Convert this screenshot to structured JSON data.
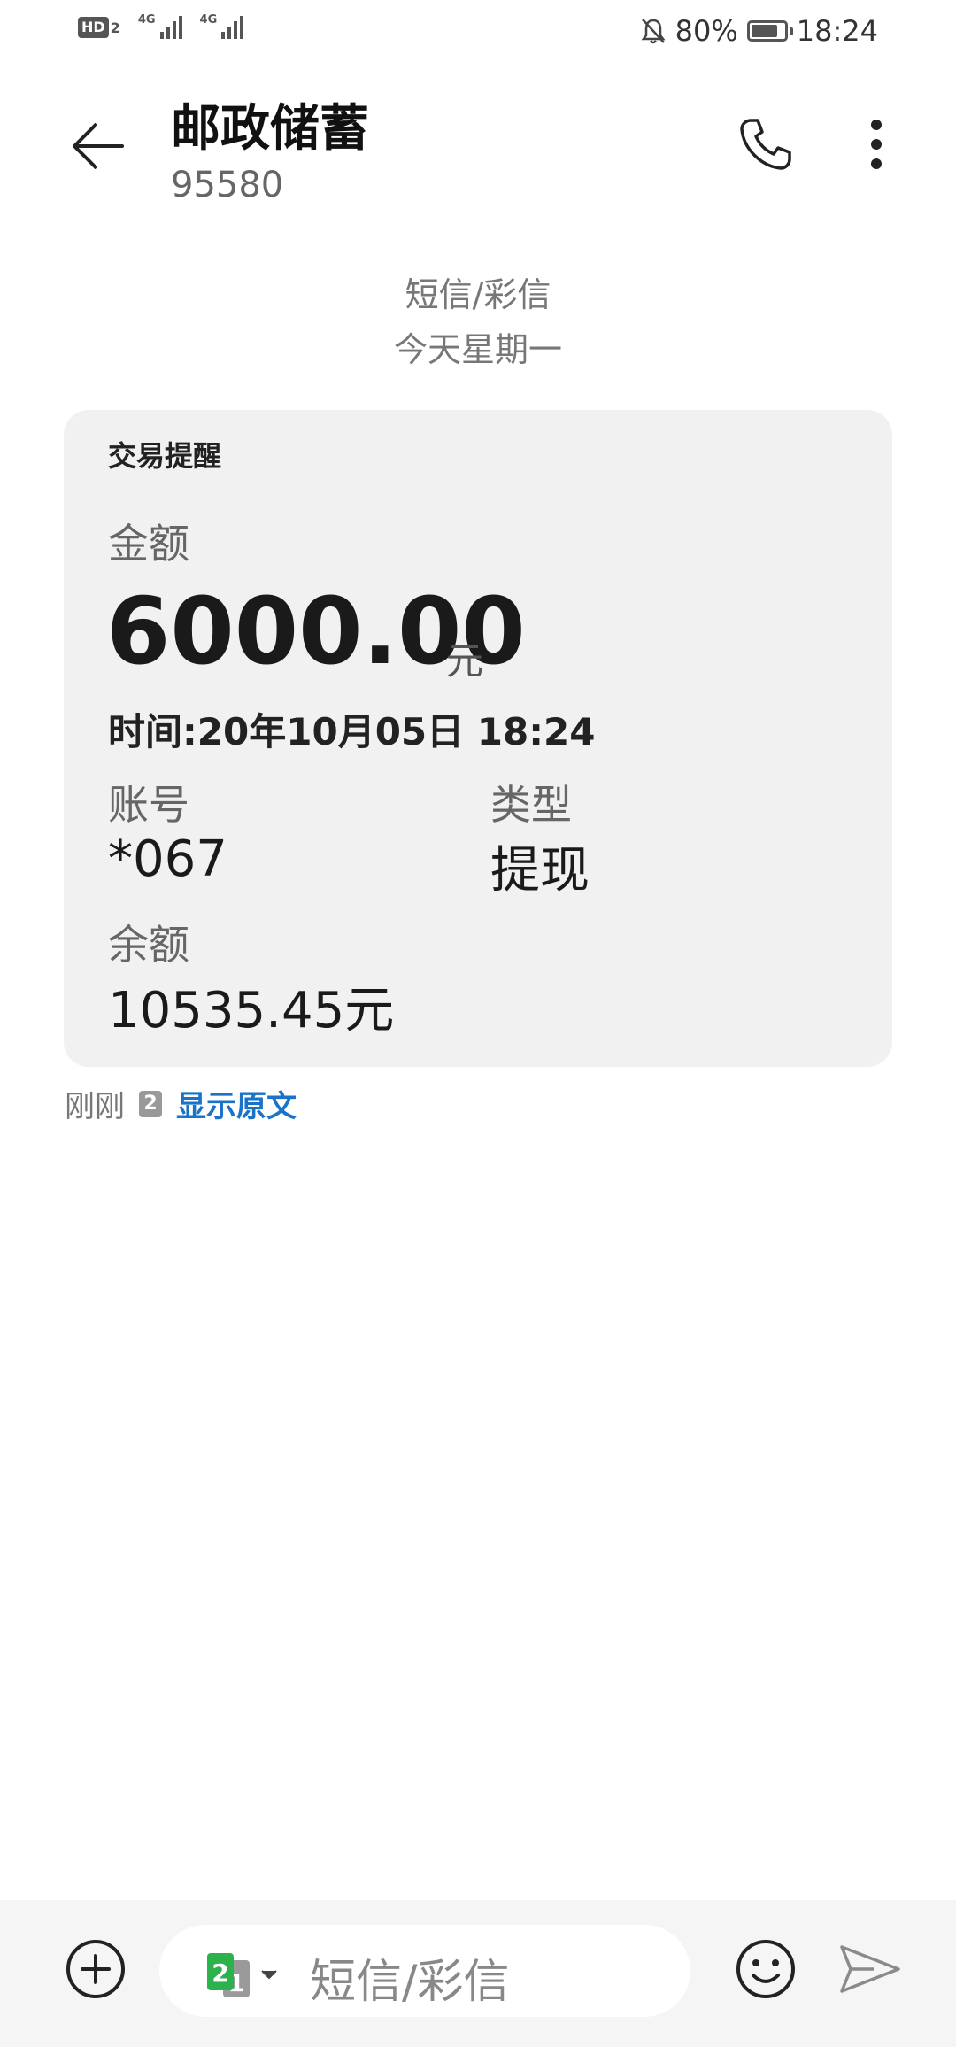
{
  "status_bar": {
    "hd_label": "HD",
    "hd_sub": "2",
    "net1_label": "4G",
    "net2_label": "4G",
    "battery_text": "80%",
    "battery_level": 0.8,
    "time": "18:24",
    "icons": [
      "bell-muted-icon",
      "battery-icon",
      "signal-icon"
    ]
  },
  "header": {
    "title": "邮政储蓄",
    "number": "95580",
    "icons": [
      "back-arrow-icon",
      "phone-icon",
      "more-vert-icon"
    ]
  },
  "conversation": {
    "type_label": "短信/彩信",
    "day_label": "今天星期一"
  },
  "message_card": {
    "title": "交易提醒",
    "amount_label": "金额",
    "amount_value": "6000.00",
    "amount_unit": "元",
    "time_line": "时间:20年10月05日 18:24",
    "account_label": "账号",
    "account_value": "*067",
    "type_label": "类型",
    "type_value": "提现",
    "balance_label": "余额",
    "balance_value": "10535.45元"
  },
  "message_meta": {
    "time": "刚刚",
    "sim": "2",
    "show_original": "显示原文"
  },
  "composer": {
    "placeholder": "短信/彩信",
    "sim_front": "2",
    "sim_back": "1",
    "sim_color": "#2bb24c",
    "icons": [
      "add-circle-icon",
      "sim-switch-icon",
      "emoji-icon",
      "send-icon"
    ]
  }
}
